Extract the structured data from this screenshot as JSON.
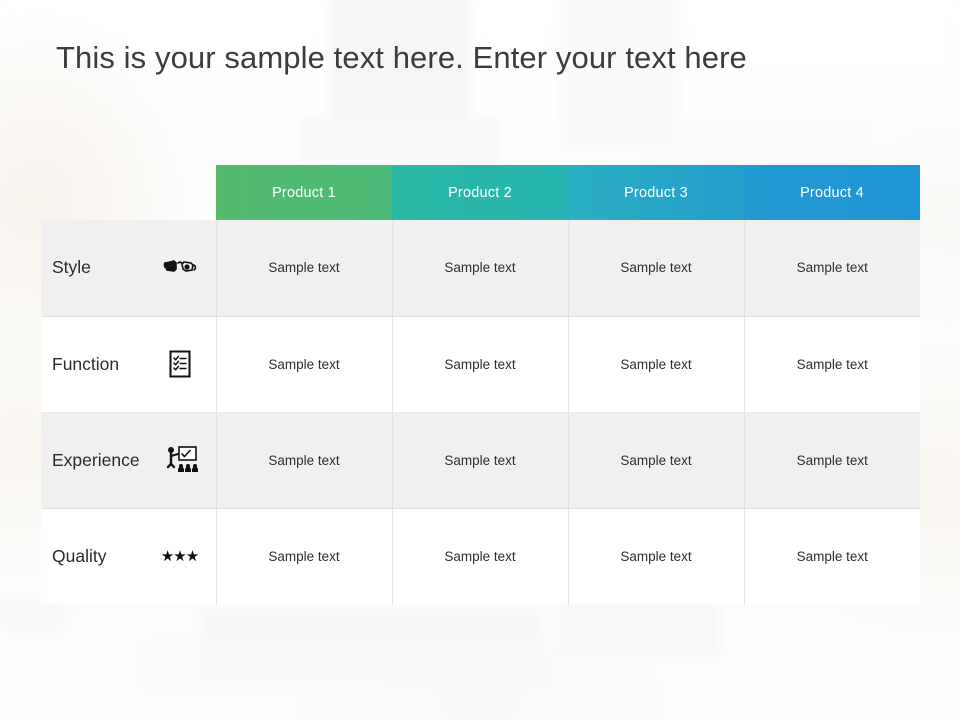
{
  "slide": {
    "title": "This is your sample text here. Enter your text here"
  },
  "table": {
    "label_column_header": "",
    "headers": [
      {
        "label": "Product 1",
        "color": "#55bb6d"
      },
      {
        "label": "Product 2",
        "color": "#28b6aa"
      },
      {
        "label": "Product 3",
        "color": "#27a7c7"
      },
      {
        "label": "Product 4",
        "color": "#2196d4"
      }
    ],
    "rows": [
      {
        "label": "Style",
        "icon": "3d-glasses-icon",
        "cells": [
          "Sample text",
          "Sample text",
          "Sample text",
          "Sample text"
        ]
      },
      {
        "label": "Function",
        "icon": "checklist-clipboard-icon",
        "cells": [
          "Sample text",
          "Sample text",
          "Sample text",
          "Sample text"
        ]
      },
      {
        "label": "Experience",
        "icon": "presenter-whiteboard-icon",
        "cells": [
          "Sample text",
          "Sample text",
          "Sample text",
          "Sample text"
        ]
      },
      {
        "label": "Quality",
        "icon": "three-stars-icon",
        "stars": "★★★",
        "cells": [
          "Sample text",
          "Sample text",
          "Sample text",
          "Sample text"
        ]
      }
    ]
  }
}
